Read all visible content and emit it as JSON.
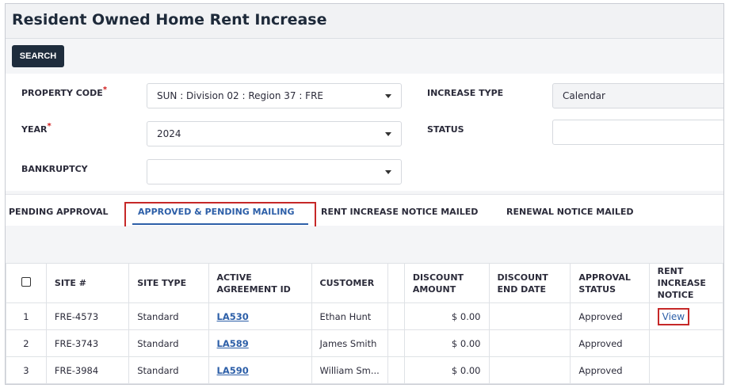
{
  "page": {
    "title": "Resident Owned Home Rent Increase"
  },
  "toolbar": {
    "search_label": "SEARCH"
  },
  "filters": {
    "property_code": {
      "label": "PROPERTY CODE",
      "required_mark": "*",
      "value": "SUN : Division 02 : Region 37 : FRE"
    },
    "year": {
      "label": "YEAR",
      "required_mark": "*",
      "value": "2024"
    },
    "bankruptcy": {
      "label": "BANKRUPTCY",
      "value": ""
    },
    "increase_type": {
      "label": "INCREASE TYPE",
      "value": "Calendar"
    },
    "status": {
      "label": "STATUS",
      "value": ""
    }
  },
  "tabs": [
    {
      "label": "PENDING APPROVAL"
    },
    {
      "label": "APPROVED & PENDING MAILING"
    },
    {
      "label": "RENT INCREASE NOTICE MAILED"
    },
    {
      "label": "RENEWAL NOTICE MAILED"
    }
  ],
  "active_tab": "APPROVED & PENDING MAILING",
  "table": {
    "headers": {
      "site": "SITE #",
      "site_type": "SITE TYPE",
      "agreement": "ACTIVE AGREEMENT ID",
      "customer": "CUSTOMER",
      "discount_amount": "DISCOUNT AMOUNT",
      "discount_end": "DISCOUNT END DATE",
      "approval": "APPROVAL STATUS",
      "notice": "RENT INCREASE NOTICE"
    },
    "rows": [
      {
        "n": "1",
        "site": "FRE-4573",
        "type": "Standard",
        "agreement": "LA530",
        "customer": "Ethan Hunt",
        "amount": "$ 0.00",
        "end": "",
        "approval": "Approved",
        "notice": "View"
      },
      {
        "n": "2",
        "site": "FRE-3743",
        "type": "Standard",
        "agreement": "LA589",
        "customer": "James Smith",
        "amount": "$ 0.00",
        "end": "",
        "approval": "Approved",
        "notice": ""
      },
      {
        "n": "3",
        "site": "FRE-3984",
        "type": "Standard",
        "agreement": "LA590",
        "customer": "William Sm...",
        "amount": "$ 0.00",
        "end": "",
        "approval": "Approved",
        "notice": ""
      }
    ]
  },
  "colors": {
    "accent": "#2d5fa8",
    "button_bg": "#1f2d3d",
    "highlight": "#c62828",
    "required": "#d11a1a"
  }
}
